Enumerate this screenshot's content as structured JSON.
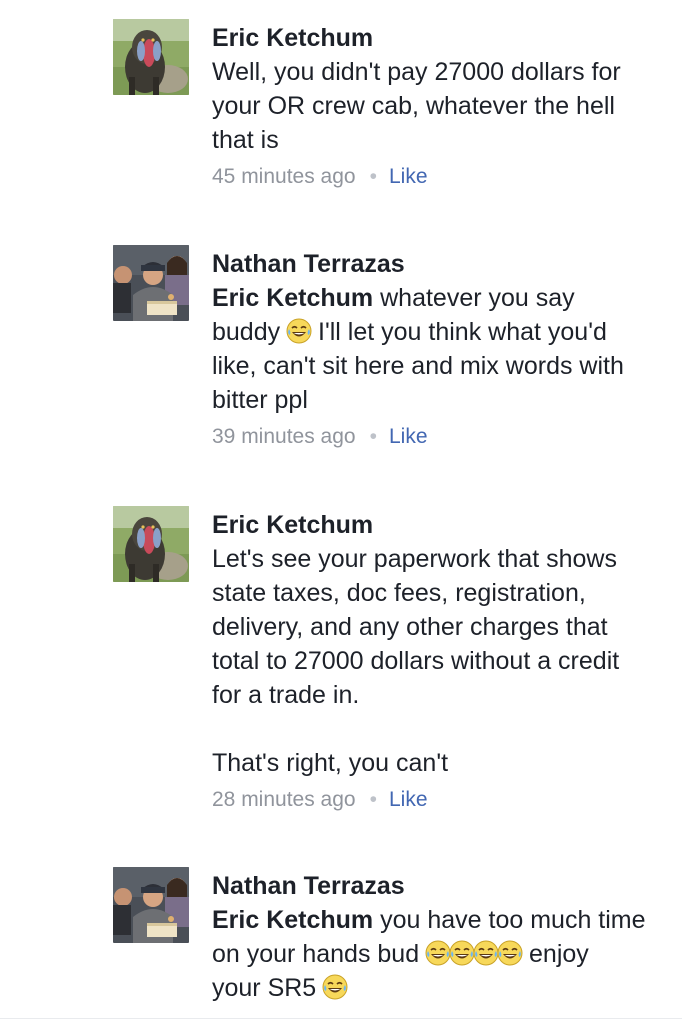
{
  "comments": [
    {
      "author": "Eric Ketchum",
      "lines": [
        "Well, you didn't pay 27000 dollars for",
        "your OR crew cab, whatever the hell",
        "that is"
      ],
      "time": "45 minutes ago",
      "like": "Like",
      "avatar": "mandrill-avatar"
    },
    {
      "author": "Nathan Terrazas",
      "mention": "Eric Ketchum",
      "line1_rest": " whatever you say",
      "line2_a": "buddy ",
      "line2_b": " I'll let you think what you'd",
      "line3": "like, can't sit here and mix words with",
      "line4": "bitter ppl",
      "time": "39 minutes ago",
      "like": "Like",
      "avatar": "family-photo-avatar"
    },
    {
      "author": "Eric Ketchum",
      "lines": [
        "Let's see your paperwork that shows",
        "state taxes, doc fees, registration,",
        "delivery, and any other charges that",
        "total to 27000 dollars without a credit",
        "for a trade in."
      ],
      "line_after_break": "That's right, you can't",
      "time": "28 minutes ago",
      "like": "Like",
      "avatar": "mandrill-avatar"
    },
    {
      "author": "Nathan Terrazas",
      "mention": "Eric Ketchum",
      "line1_rest": " you have too much time",
      "line2_a": "on your hands bud ",
      "line2_b": " enjoy",
      "line3_a": "your SR5 ",
      "avatar": "family-photo-avatar"
    }
  ],
  "separator": "•",
  "colors": {
    "text": "#1d2129",
    "meta": "#90949c",
    "like": "#4267b2"
  },
  "icons": {
    "emoji": "face-with-tears-of-joy-icon"
  }
}
